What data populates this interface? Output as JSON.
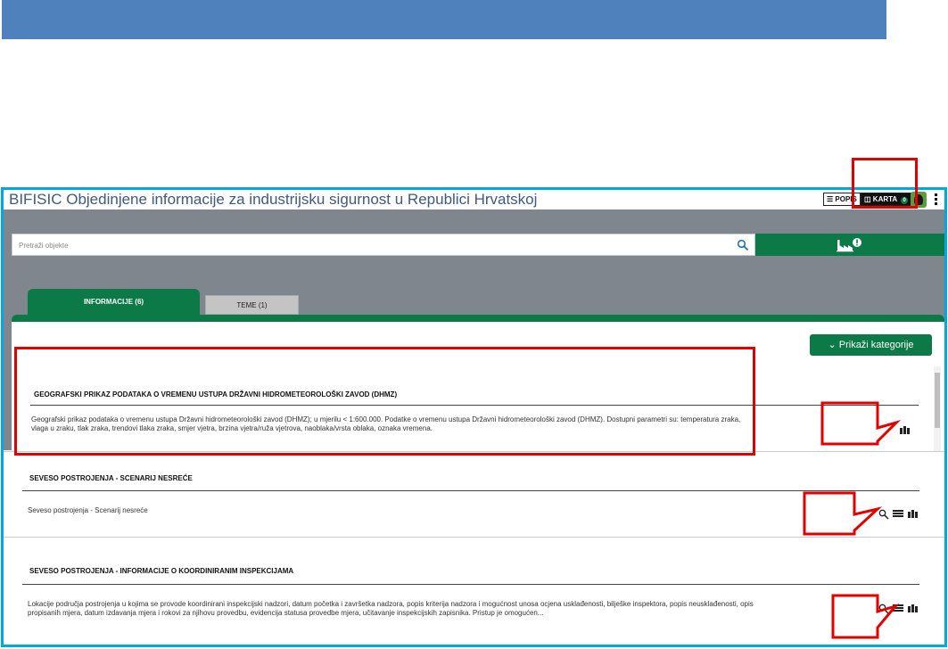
{
  "app": {
    "title": "BIFISIC Objedinjene informacije za industrijsku sigurnost u Republici Hrvatskoj",
    "popis_label": "POPIS",
    "karta_label": "KARTA",
    "karta_count": "0"
  },
  "search": {
    "placeholder": "Pretraži objekte"
  },
  "tabs": [
    {
      "label": "INFORMACIJE (6)",
      "active": true
    },
    {
      "label": "TEME (1)",
      "active": false
    }
  ],
  "categories_button": {
    "label": "Prikaži kategorije"
  },
  "items": [
    {
      "title": "GEOGRAFSKI PRIKAZ PODATAKA O VREMENU USTUPA DRŽAVNI HIDROMETEOROLOŠKI ZAVOD (DHMZ)",
      "description": "Geografski prikaz podataka o vremenu ustupa Državni hidrometeorološki zavod (DHMZ); u mjerilu < 1:600.000. Podatke o vremenu ustupa Državni hidrometeorološki zavod (DHMZ). Dostupni parametri su: temperatura zraka, vlaga u zraku, tlak zraka, trendovi tlaka zraka, smjer vjetra, brzina vjetra/ruža vjetrova, naoblaka/vrsta oblaka, oznaka vremena.",
      "actions": [
        "map-icon"
      ]
    },
    {
      "title": "SEVESO POSTROJENJA - SCENARIJ NESREĆE",
      "description": "Seveso postrojenja - Scenarij nesreće",
      "actions": [
        "search-icon",
        "list-icon",
        "map-icon"
      ]
    },
    {
      "title": "SEVESO POSTROJENJA - INFORMACIJE O KOORDINIRANIM INSPEKCIJAMA",
      "description": "Lokacije područja postrojenja u kojima se provode koordinirani inspekcijski nadzori, datum početka i završetka nadzora, popis kriterija nadzora i mogućnost unosa ocjena usklađenosti, bilješke inspektora, popis neusklađenosti, opis propisanih mjera, datum izdavanja mjera i rokovi za njihovu provedbu, evidencija statusa provedbe mjera, učitavanje inspekcijskih zapisnika. Pristup je omogućen...",
      "actions": [
        "search-icon",
        "list-icon",
        "map-icon"
      ]
    }
  ],
  "colors": {
    "banner": "#4f81bd",
    "frame": "#00a7e1",
    "highlight": "#e00000",
    "brand_green": "#0b7a47",
    "gray_background": "#7f868d"
  }
}
